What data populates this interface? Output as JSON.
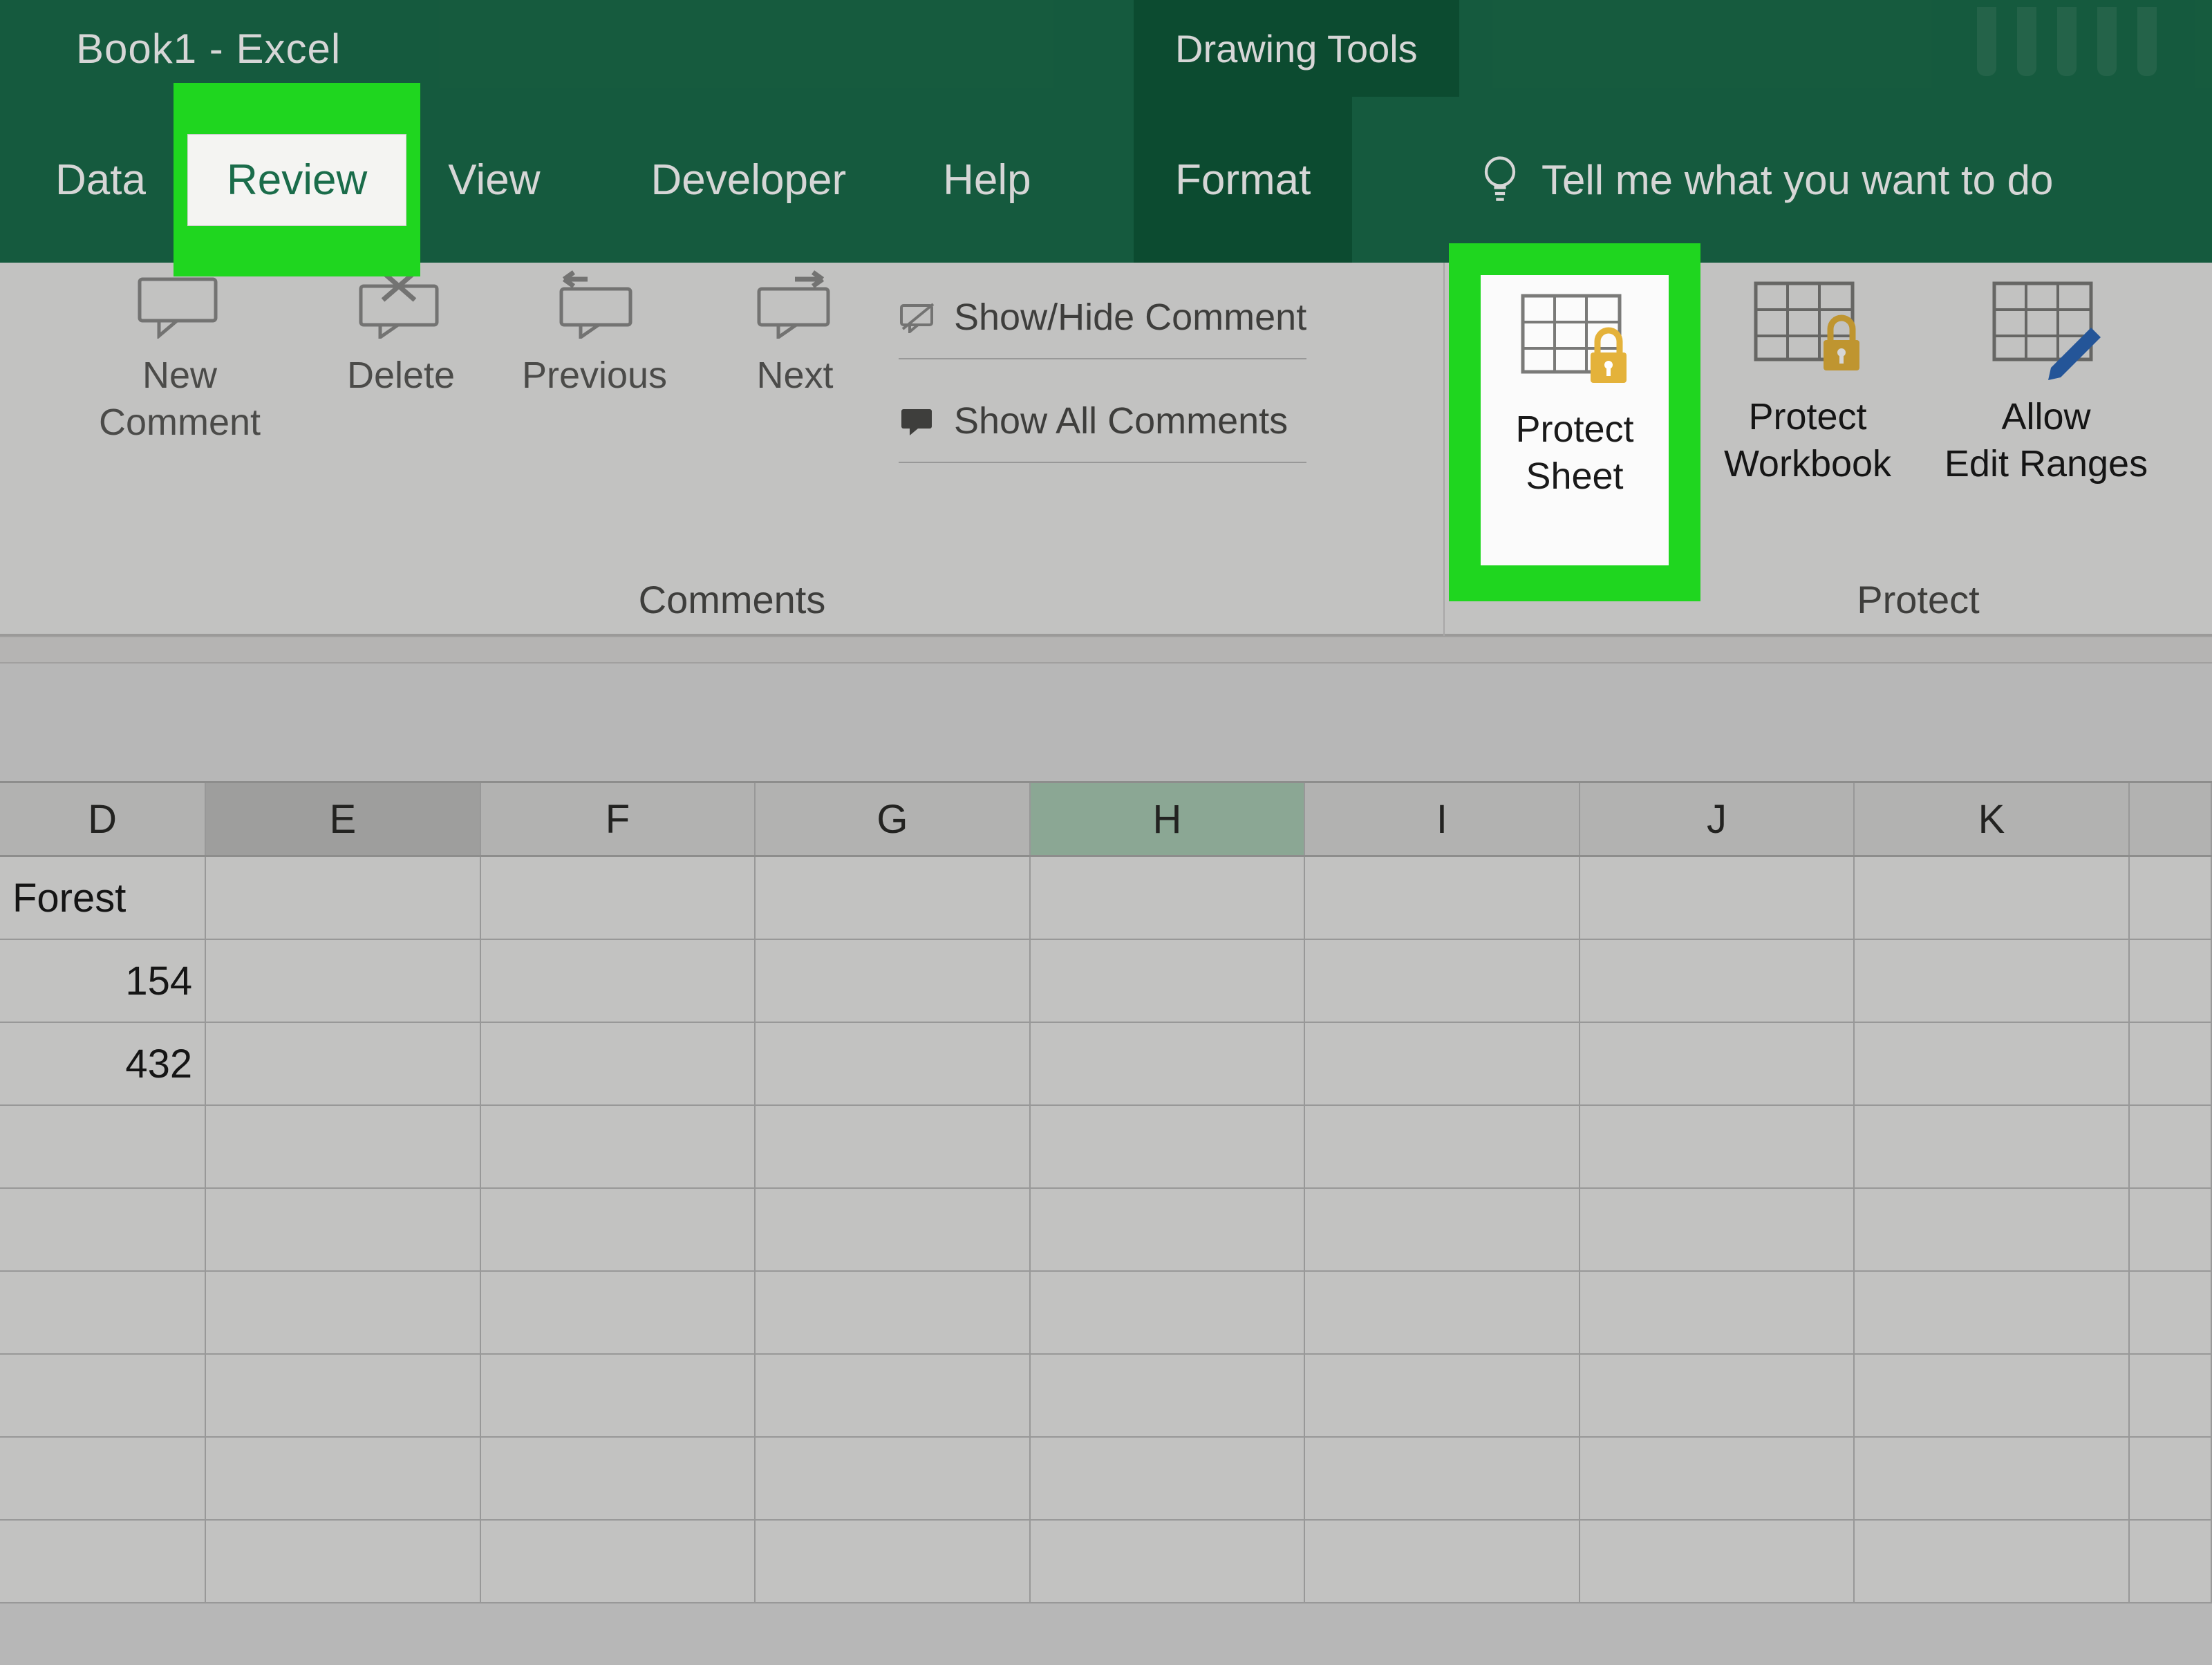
{
  "title": "Book1  -  Excel",
  "contextual_tab": "Drawing Tools",
  "ribbon_tabs": {
    "data": "Data",
    "review": "Review",
    "view": "View",
    "developer": "Developer",
    "help": "Help",
    "format": "Format"
  },
  "tellme": "Tell me what you want to do",
  "comments_group": {
    "label": "Comments",
    "new_comment": "New Comment",
    "delete": "Delete",
    "previous": "Previous",
    "next": "Next",
    "show_hide": "Show/Hide Comment",
    "show_all": "Show All Comments"
  },
  "protect_group": {
    "label": "Protect",
    "protect_sheet": "Protect Sheet",
    "protect_workbook": "Protect Workbook",
    "allow_edit": "Allow Edit Ranges"
  },
  "columns": [
    "D",
    "E",
    "F",
    "G",
    "H",
    "I",
    "J",
    "K"
  ],
  "selected_column": "H",
  "active_column": "E",
  "cells": {
    "D1": "Forest",
    "D2": "154",
    "D3": "432"
  }
}
